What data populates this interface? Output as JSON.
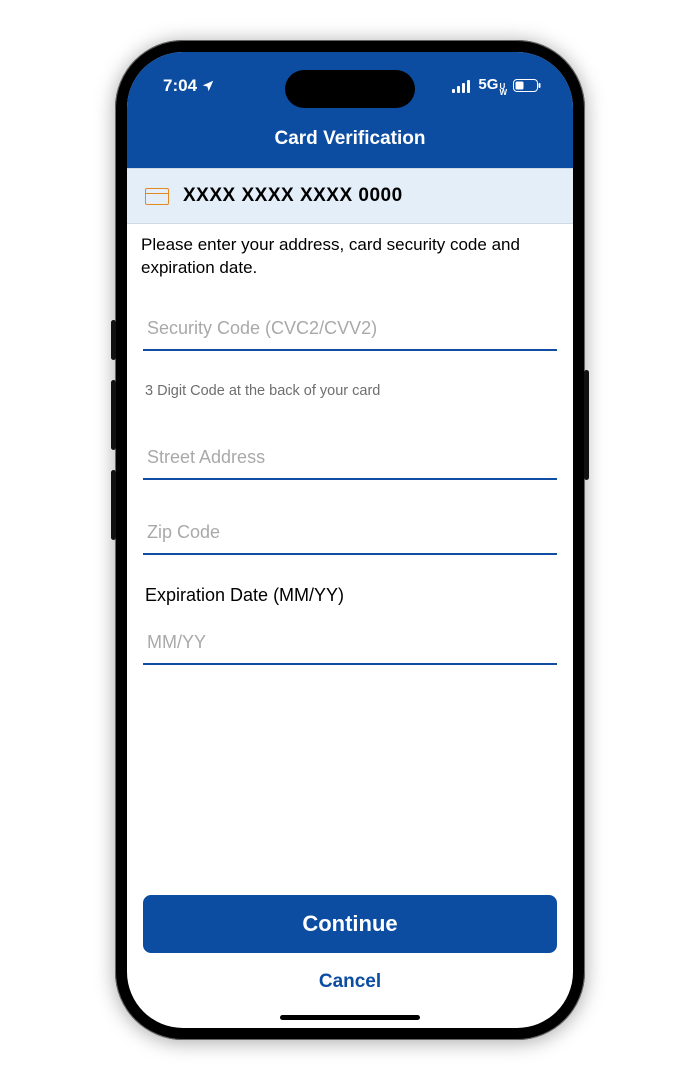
{
  "status": {
    "time": "7:04",
    "network_label": "5G",
    "network_suffix": "U\nW"
  },
  "header": {
    "title": "Card Verification"
  },
  "card": {
    "masked_number": "XXXX XXXX XXXX 0000"
  },
  "instruction": "Please enter your address, card security code and expiration date.",
  "fields": {
    "cvc": {
      "placeholder": "Security Code (CVC2/CVV2)",
      "value": "",
      "helper": "3 Digit Code at the back of your card"
    },
    "street": {
      "placeholder": "Street Address",
      "value": ""
    },
    "zip": {
      "placeholder": "Zip Code",
      "value": ""
    },
    "exp": {
      "label": "Expiration Date (MM/YY)",
      "placeholder": "MM/YY",
      "value": ""
    }
  },
  "buttons": {
    "continue": "Continue",
    "cancel": "Cancel"
  }
}
